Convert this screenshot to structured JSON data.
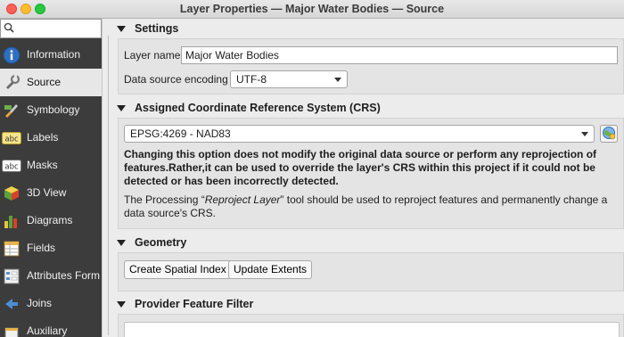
{
  "window": {
    "title": "Layer Properties — Major Water Bodies — Source"
  },
  "sidebar": {
    "search": {
      "value": "",
      "placeholder": ""
    },
    "items": [
      {
        "label": "Information",
        "icon": "info-icon"
      },
      {
        "label": "Source",
        "icon": "source-icon",
        "active": true
      },
      {
        "label": "Symbology",
        "icon": "symbology-icon"
      },
      {
        "label": "Labels",
        "icon": "labels-icon"
      },
      {
        "label": "Masks",
        "icon": "masks-icon"
      },
      {
        "label": "3D View",
        "icon": "3d-view-icon"
      },
      {
        "label": "Diagrams",
        "icon": "diagrams-icon"
      },
      {
        "label": "Fields",
        "icon": "fields-icon"
      },
      {
        "label": "Attributes Form",
        "icon": "attributes-form-icon"
      },
      {
        "label": "Joins",
        "icon": "joins-icon"
      },
      {
        "label": "Auxiliary",
        "icon": "auxiliary-icon"
      }
    ]
  },
  "settings": {
    "header": "Settings",
    "layer_name_label": "Layer name",
    "layer_name_value": "Major Water Bodies",
    "encoding_label": "Data source encoding",
    "encoding_value": "UTF-8"
  },
  "crs": {
    "header": "Assigned Coordinate Reference System (CRS)",
    "value": "EPSG:4269 - NAD83",
    "warning": "Changing this option does not modify the original data source or perform any reprojection of features.Rather,it can be used to override the layer's CRS within this project if it could not be detected or has been incorrectly detected.",
    "note_prefix": "The Processing “",
    "note_tool": "Reproject Layer",
    "note_suffix": "” tool should be used to reproject features and permanently change a data source's CRS."
  },
  "geometry": {
    "header": "Geometry",
    "create_index_label": "Create Spatial Index",
    "update_extents_label": "Update Extents"
  },
  "filter": {
    "header": "Provider Feature Filter"
  },
  "colors": {
    "sidebar_bg": "#3c3c3c",
    "active_item_bg": "#e7e7e7",
    "panel_bg": "#e4e4e4"
  }
}
